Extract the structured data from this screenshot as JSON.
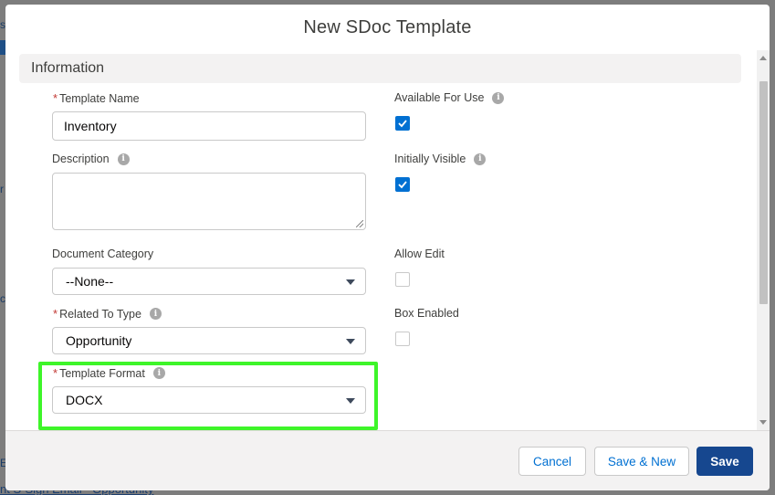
{
  "background": {
    "fragments": [
      "s",
      "r",
      "c",
      "E"
    ],
    "link_text": "nt S-Sign Email - Opportunity"
  },
  "modal": {
    "title": "New SDoc Template",
    "section_title": "Information"
  },
  "fields": {
    "template_name": {
      "label": "Template Name",
      "required": "*",
      "value": "Inventory"
    },
    "description": {
      "label": "Description",
      "value": ""
    },
    "document_category": {
      "label": "Document Category",
      "value": "--None--"
    },
    "related_to_type": {
      "label": "Related To Type",
      "required": "*",
      "value": "Opportunity"
    },
    "template_format": {
      "label": "Template Format",
      "required": "*",
      "value": "DOCX"
    },
    "available_for_use": {
      "label": "Available For Use",
      "checked": true
    },
    "initially_visible": {
      "label": "Initially Visible",
      "checked": true
    },
    "allow_edit": {
      "label": "Allow Edit",
      "checked": false
    },
    "box_enabled": {
      "label": "Box Enabled",
      "checked": false
    }
  },
  "footer": {
    "cancel_label": "Cancel",
    "save_new_label": "Save & New",
    "save_label": "Save"
  },
  "icons": {
    "info": "info-icon",
    "check": "check-icon",
    "dropdown": "chevron-down-icon"
  },
  "colors": {
    "brand": "#16478f",
    "checkbox_checked": "#0070d2",
    "required": "#c23934",
    "highlight": "#3ef529"
  }
}
